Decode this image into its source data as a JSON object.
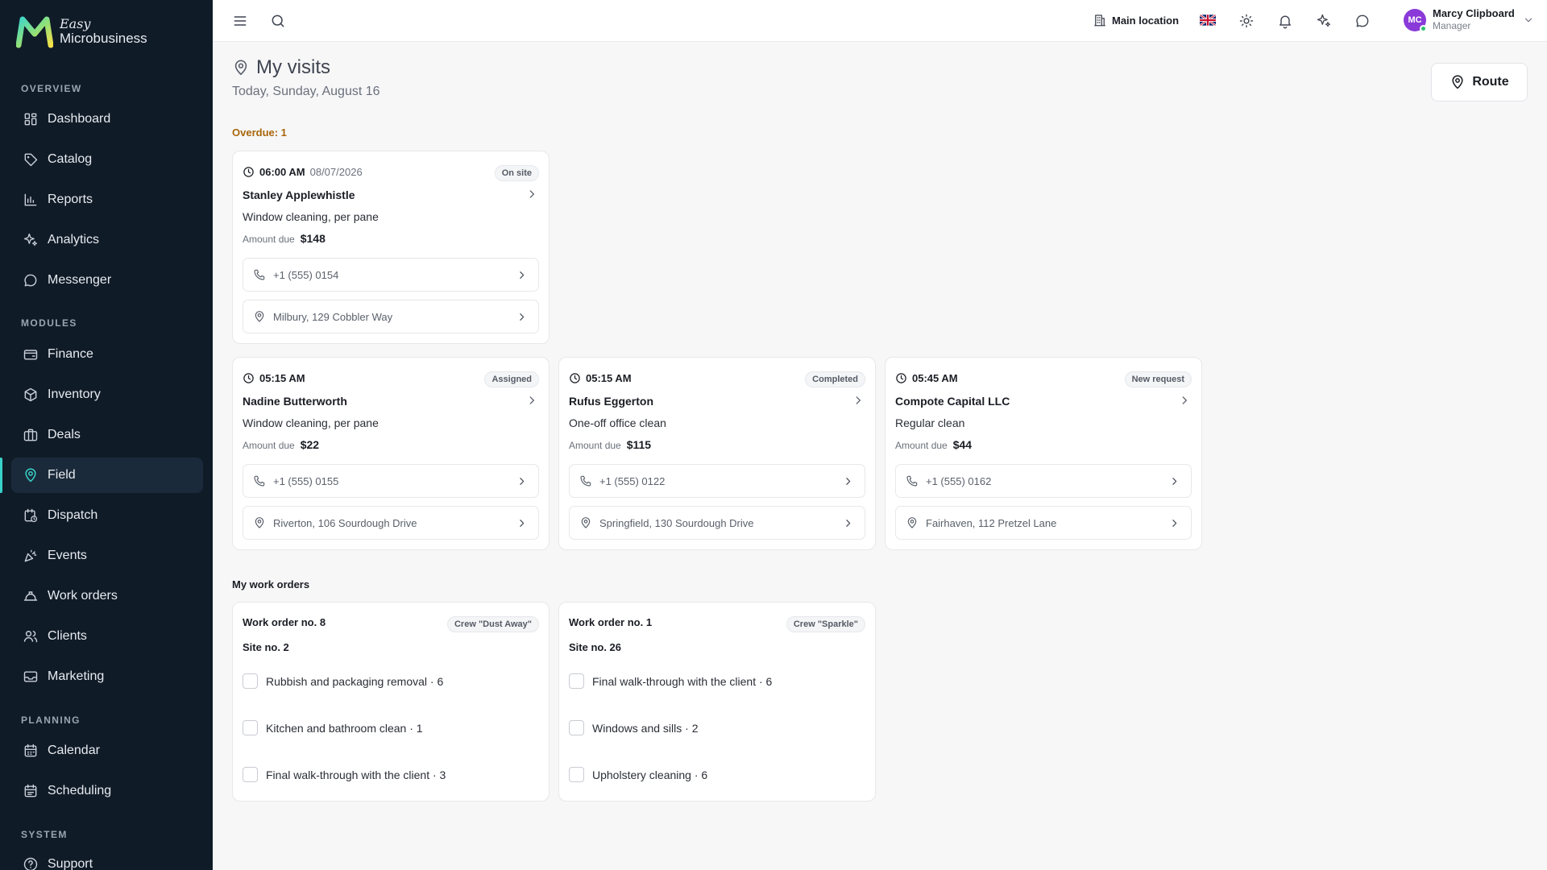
{
  "brand": {
    "line1": "Easy",
    "line2": "Microbusiness"
  },
  "sidebar": {
    "sections": {
      "overview": "OVERVIEW",
      "modules": "MODULES",
      "planning": "PLANNING",
      "system": "SYSTEM"
    },
    "items": [
      {
        "label": "Dashboard",
        "icon": "dashboard-icon"
      },
      {
        "label": "Catalog",
        "icon": "catalog-icon"
      },
      {
        "label": "Reports",
        "icon": "reports-icon"
      },
      {
        "label": "Analytics",
        "icon": "analytics-icon"
      },
      {
        "label": "Messenger",
        "icon": "messenger-icon"
      },
      {
        "label": "Finance",
        "icon": "finance-icon"
      },
      {
        "label": "Inventory",
        "icon": "inventory-icon"
      },
      {
        "label": "Deals",
        "icon": "deals-icon"
      },
      {
        "label": "Field",
        "icon": "field-icon",
        "active": true
      },
      {
        "label": "Dispatch",
        "icon": "dispatch-icon"
      },
      {
        "label": "Events",
        "icon": "events-icon"
      },
      {
        "label": "Work orders",
        "icon": "work-orders-icon"
      },
      {
        "label": "Clients",
        "icon": "clients-icon"
      },
      {
        "label": "Marketing",
        "icon": "marketing-icon"
      },
      {
        "label": "Calendar",
        "icon": "calendar-icon"
      },
      {
        "label": "Scheduling",
        "icon": "scheduling-icon"
      },
      {
        "label": "Support",
        "icon": "support-icon"
      }
    ]
  },
  "topbar": {
    "location": "Main location",
    "user": {
      "initials": "MC",
      "name": "Marcy Clipboard",
      "role": "Manager"
    }
  },
  "page": {
    "title": "My visits",
    "subtitle": "Today, Sunday, August 16",
    "route_label": "Route",
    "overdue_label": "Overdue: 1"
  },
  "visits": [
    {
      "time": "06:00 AM",
      "date": "08/07/2026",
      "status": "On site",
      "client": "Stanley Applewhistle",
      "service": "Window cleaning, per pane",
      "amount_label": "Amount due",
      "amount": "$148",
      "phone": "+1 (555) 0154",
      "address": "Milbury, 129 Cobbler Way"
    },
    {
      "time": "05:15 AM",
      "date": "",
      "status": "Assigned",
      "client": "Nadine Butterworth",
      "service": "Window cleaning, per pane",
      "amount_label": "Amount due",
      "amount": "$22",
      "phone": "+1 (555) 0155",
      "address": "Riverton, 106 Sourdough Drive"
    },
    {
      "time": "05:15 AM",
      "date": "",
      "status": "Completed",
      "client": "Rufus Eggerton",
      "service": "One-off office clean",
      "amount_label": "Amount due",
      "amount": "$115",
      "phone": "+1 (555) 0122",
      "address": "Springfield, 130 Sourdough Drive"
    },
    {
      "time": "05:45 AM",
      "date": "",
      "status": "New request",
      "client": "Compote Capital LLC",
      "service": "Regular clean",
      "amount_label": "Amount due",
      "amount": "$44",
      "phone": "+1 (555) 0162",
      "address": "Fairhaven, 112 Pretzel Lane"
    }
  ],
  "work_orders_heading": "My work orders",
  "work_orders": [
    {
      "title": "Work order no. 8",
      "crew": "Crew \"Dust Away\"",
      "site": "Site no. 2",
      "tasks": [
        "Rubbish and packaging removal · 6",
        "Kitchen and bathroom clean · 1",
        "Final walk-through with the client · 3"
      ]
    },
    {
      "title": "Work order no. 1",
      "crew": "Crew \"Sparkle\"",
      "site": "Site no. 26",
      "tasks": [
        "Final walk-through with the client · 6",
        "Windows and sills · 2",
        "Upholstery cleaning · 6"
      ]
    }
  ],
  "colors": {
    "sidebar_bg": "#101b28",
    "accent": "#38d0c7",
    "overdue": "#a8660a",
    "avatar": "#8a3ad8",
    "online": "#2fbf71"
  }
}
